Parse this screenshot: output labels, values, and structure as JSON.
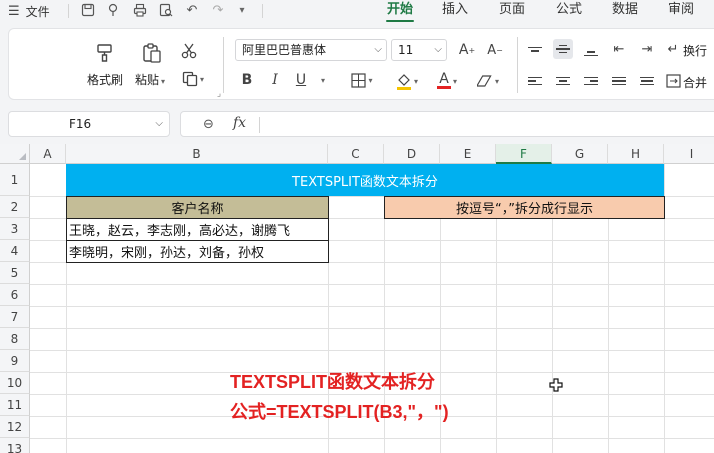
{
  "menubar": {
    "file_label": "文件",
    "tabs": [
      {
        "label": "开始",
        "active": true
      },
      {
        "label": "插入",
        "active": false
      },
      {
        "label": "页面",
        "active": false
      },
      {
        "label": "公式",
        "active": false
      },
      {
        "label": "数据",
        "active": false
      },
      {
        "label": "审阅",
        "active": false
      }
    ],
    "accent_color": "#1f7a45"
  },
  "ribbon": {
    "format_painter_label": "格式刷",
    "paste_label": "粘贴",
    "font_name": "阿里巴巴普惠体",
    "font_size": "11",
    "bold_label": "B",
    "italic_label": "I",
    "underline_label": "U",
    "font_color_label": "A",
    "wrap_label": "换行",
    "merge_label": "合并"
  },
  "formula_bar": {
    "name_box": "F16",
    "fx_label": "fx",
    "formula": ""
  },
  "sheet": {
    "columns": [
      "A",
      "B",
      "C",
      "D",
      "E",
      "F",
      "G",
      "H",
      "I"
    ],
    "selected_column": "F",
    "rows": [
      "1",
      "2",
      "3",
      "4",
      "5",
      "6",
      "7",
      "8",
      "9",
      "10",
      "11",
      "12",
      "13"
    ],
    "banner_text": "TEXTSPLIT函数文本拆分",
    "b_header": "客户名称",
    "b3": "王晓，赵云，李志刚，高必达，谢腾飞",
    "b4": "李晓明，宋刚，孙达，刘备，孙权",
    "dg_header": "按逗号“，”拆分成行显示",
    "note_line1": "TEXTSPLIT函数文本拆分",
    "note_line2": "公式=TEXTSPLIT(B3,\"，\")",
    "banner_color": "#00b0f0",
    "b_header_color": "#c4bd97",
    "dg_header_color": "#f8cbad",
    "note_color": "#e32222"
  }
}
